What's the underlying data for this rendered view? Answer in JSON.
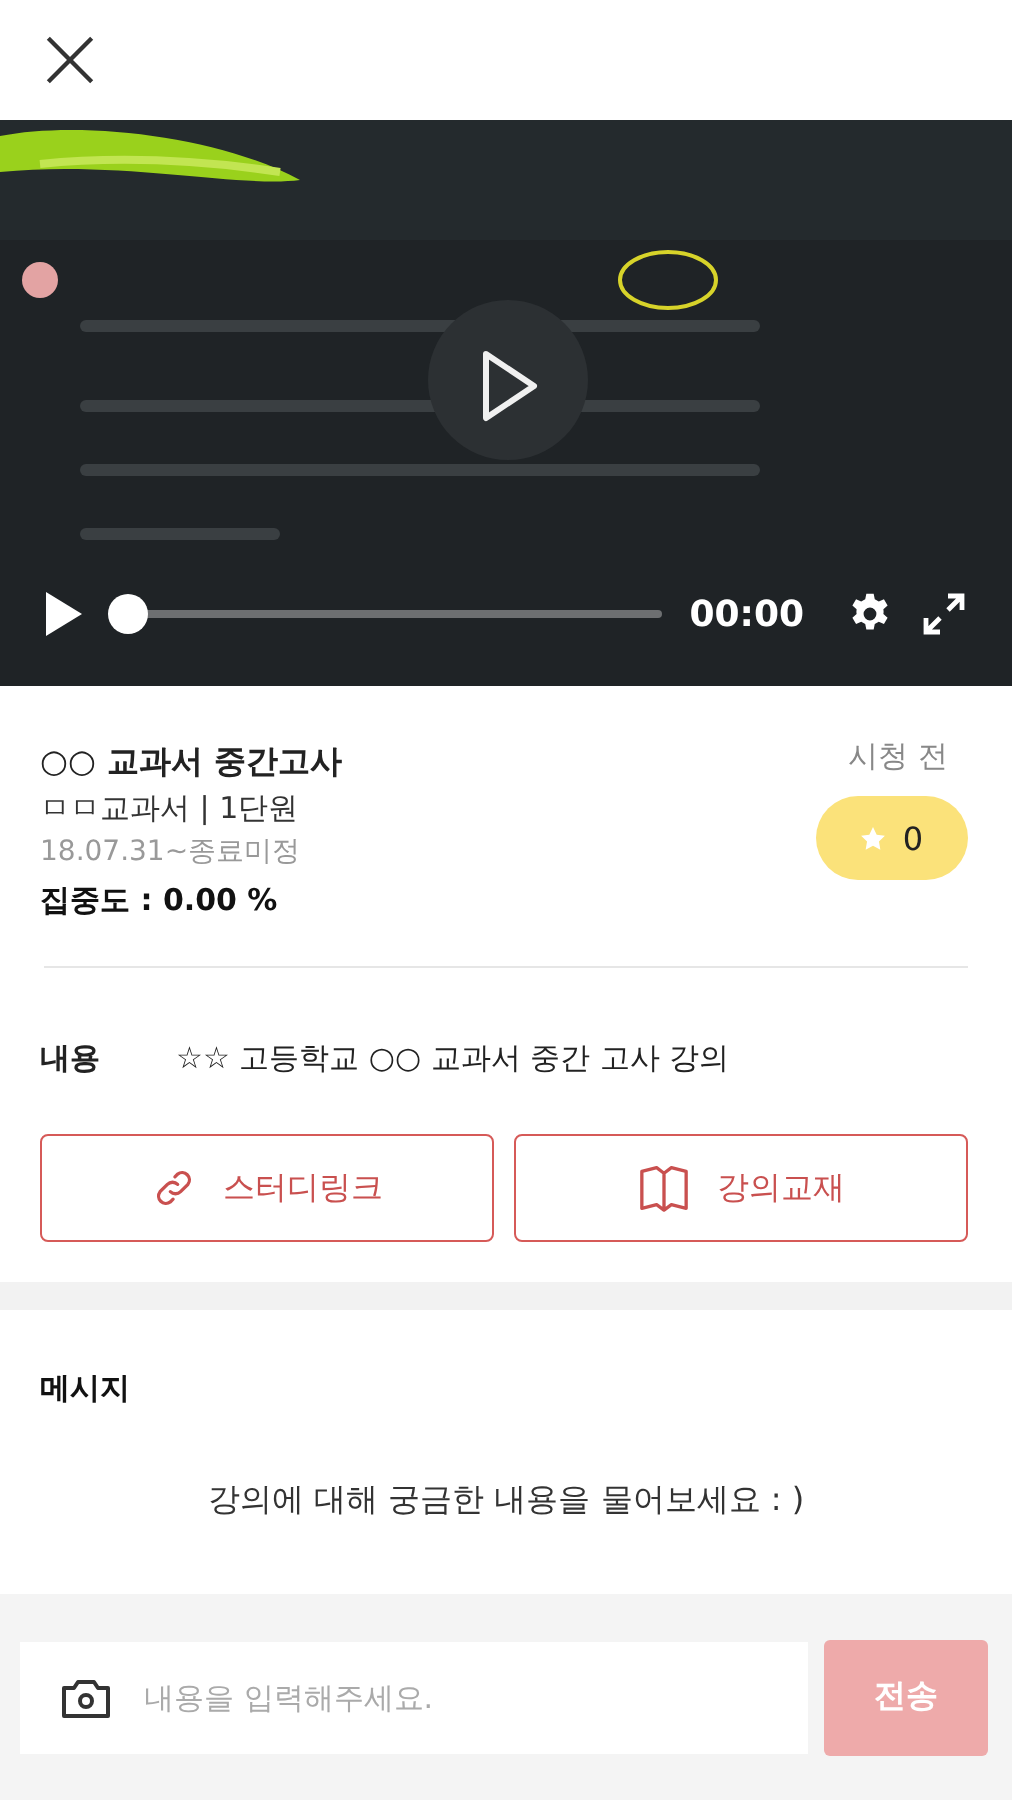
{
  "video": {
    "kind": "picture",
    "time": "00:00",
    "level": 0
  },
  "lecture": {
    "title": "○○ 교과서 중간고사",
    "subtitle": "ㅁㅁ교과서 | 1단원",
    "period": "18.07.31~종료미정",
    "focus": "집중도 : 0.00 %",
    "status": "시청 전",
    "star_count": "0"
  },
  "content": {
    "label": "내용",
    "text": "☆☆ 고등학교 ○○ 교과서 중간 고사 강의"
  },
  "buttons": [
    {
      "kind": "link",
      "label": "스터디링크"
    },
    {
      "kind": "book",
      "label": "강의교재"
    }
  ],
  "message": {
    "title": "메시지",
    "hint": "강의에 대해 궁금한 내용을 물어보세요 : )"
  },
  "composer": {
    "placeholder": "내용을 입력해주세요.",
    "send": {
      "label": "전송",
      "disabled": true
    }
  }
}
